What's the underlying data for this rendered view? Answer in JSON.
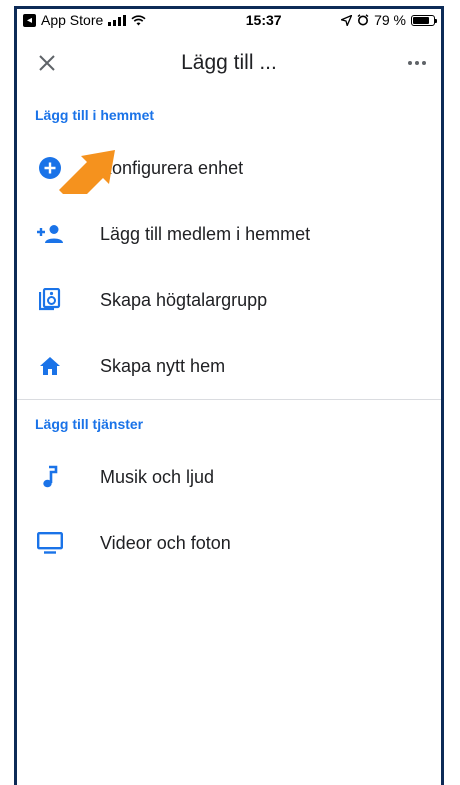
{
  "statusbar": {
    "back_app": "App Store",
    "time": "15:37",
    "battery_percent": "79 %",
    "battery_level": 0.79
  },
  "header": {
    "title": "Lägg till ...",
    "close_icon": "close-icon",
    "more_icon": "more-icon"
  },
  "sections": [
    {
      "title": "Lägg till i hemmet",
      "items": [
        {
          "label": "Konfigurera enhet",
          "icon": "add-circle-icon"
        },
        {
          "label": "Lägg till medlem i hemmet",
          "icon": "person-add-icon"
        },
        {
          "label": "Skapa högtalargrupp",
          "icon": "speaker-group-icon"
        },
        {
          "label": "Skapa nytt hem",
          "icon": "home-icon"
        }
      ]
    },
    {
      "title": "Lägg till tjänster",
      "items": [
        {
          "label": "Musik och ljud",
          "icon": "music-note-icon"
        },
        {
          "label": "Videor och foton",
          "icon": "tv-icon"
        }
      ]
    }
  ],
  "colors": {
    "accent": "#1a73e8",
    "arrow": "#f5921e",
    "frame": "#0d2b57"
  }
}
